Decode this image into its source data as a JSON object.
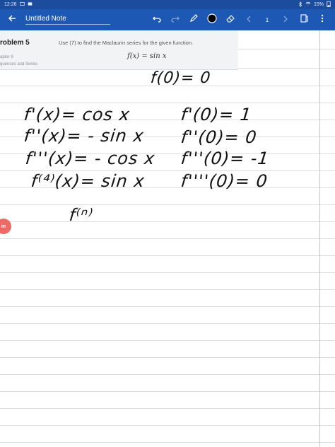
{
  "status_bar": {
    "time": "12:26",
    "battery": "15%"
  },
  "app_bar": {
    "title": "Untitled Note",
    "page_number": "1"
  },
  "problem": {
    "title": "roblem 5",
    "chapter": "apter 9",
    "section": "quences and Series",
    "description": "Use (7) to find the Maclaurin series for the given function.",
    "formula": "f(x) = sin x"
  },
  "side_badge": "m",
  "handwriting": {
    "f0": "f(0)= 0",
    "left": [
      "f'(x)= cos x",
      "f''(x)= - sin x",
      "f'''(x)= - cos x",
      "f⁽⁴⁾(x)= sin x",
      "f⁽ⁿ⁾"
    ],
    "right": [
      "f'(0)= 1",
      "f''(0)= 0",
      "f'''(0)= -1",
      "f''''(0)= 0"
    ]
  }
}
